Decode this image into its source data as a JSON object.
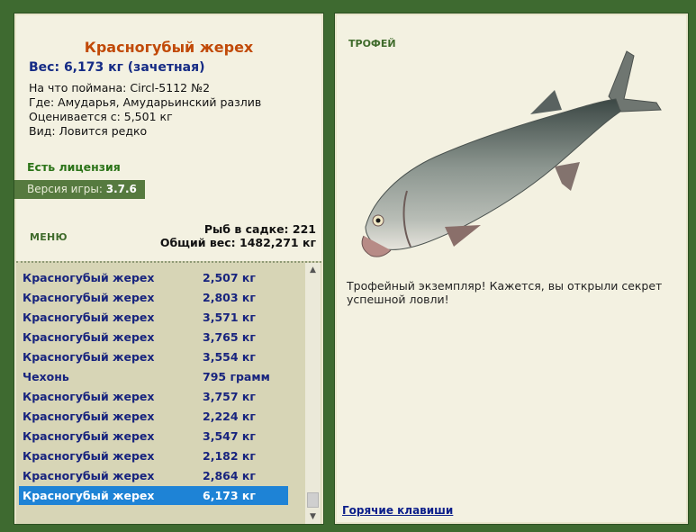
{
  "fish": {
    "name": "Красногубый жерех",
    "weight_line": "Вес: 6,173 кг (зачетная)",
    "bait": "На что поймана: Circl-5112 №2",
    "location": "Где: Амударья, Амударьинский разлив",
    "valued_from": "Оценивается с: 5,501 кг",
    "kind": "Вид: Ловится редко"
  },
  "license": "Есть лицензия",
  "version": {
    "label": "Версия игры:",
    "value": "3.7.6"
  },
  "menu": "МЕНЮ",
  "stats": {
    "count": "Рыб в садке: 221",
    "total": "Общий вес: 1482,271 кг"
  },
  "catch_list": [
    {
      "name": "Красногубый жерех",
      "weight": "2,507 кг"
    },
    {
      "name": "Красногубый жерех",
      "weight": "2,803 кг"
    },
    {
      "name": "Красногубый жерех",
      "weight": "3,571 кг"
    },
    {
      "name": "Красногубый жерех",
      "weight": "3,765 кг"
    },
    {
      "name": "Красногубый жерех",
      "weight": "3,554 кг"
    },
    {
      "name": "Чехонь",
      "weight": "795 грамм"
    },
    {
      "name": "Красногубый жерех",
      "weight": "3,757 кг"
    },
    {
      "name": "Красногубый жерех",
      "weight": "2,224 кг"
    },
    {
      "name": "Красногубый жерех",
      "weight": "3,547 кг"
    },
    {
      "name": "Красногубый жерех",
      "weight": "2,182 кг"
    },
    {
      "name": "Красногубый жерех",
      "weight": "2,864 кг"
    },
    {
      "name": "Красногубый жерех",
      "weight": "6,173 кг"
    }
  ],
  "selected_index": 11,
  "trophy": {
    "label": "ТРОФЕЙ",
    "description": "Трофейный экземпляр! Кажется, вы открыли секрет успешной ловли!",
    "hotkeys": "Горячие клавиши"
  },
  "colors": {
    "background": "#3e6a30",
    "panel": "#f3f1e1",
    "title": "#c14a08",
    "list_text": "#18247e",
    "selection": "#1e83d6"
  }
}
